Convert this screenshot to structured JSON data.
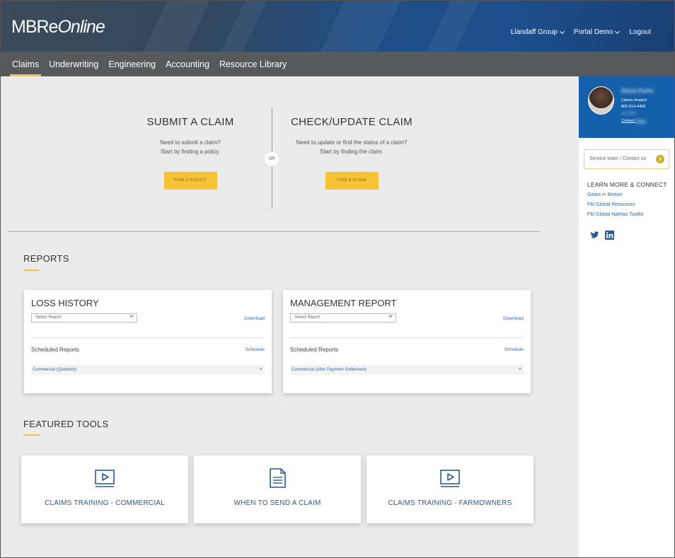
{
  "header": {
    "logo_main": "MBRe",
    "logo_italic": "Online",
    "links": [
      {
        "label": "Llandaff Group"
      },
      {
        "label": "Portal Demo"
      },
      {
        "label": "Logout"
      }
    ]
  },
  "nav": {
    "items": [
      "Claims",
      "Underwriting",
      "Engineering",
      "Accounting",
      "Resource Library"
    ],
    "active": "Claims"
  },
  "claims": {
    "submit": {
      "title": "SUBMIT A CLAIM",
      "desc_line1": "Need to submit a claim?",
      "desc_line2": "Start by finding a policy.",
      "button": "FIND A POLICY"
    },
    "or_label": "OR",
    "check": {
      "title": "CHECK/UPDATE CLAIM",
      "desc_line1": "Need to update or find the status of a claim?",
      "desc_line2": "Start by finding the claim.",
      "button": "FIND A CLAIM"
    }
  },
  "reports": {
    "section_title": "REPORTS",
    "cards": [
      {
        "title": "LOSS HISTORY",
        "select_placeholder": "Select Report",
        "download": "Download",
        "scheduled_label": "Scheduled Reports",
        "schedule_link": "Schedule",
        "scheduled_item": "Commercial (Quarterly)",
        "remove": "×"
      },
      {
        "title": "MANAGEMENT REPORT",
        "select_placeholder": "Select Report",
        "download": "Download",
        "scheduled_label": "Scheduled Reports",
        "schedule_link": "Schedule",
        "scheduled_item": "Commercial (After Payment Settlement)",
        "remove": "×"
      }
    ]
  },
  "tools": {
    "section_title": "FEATURED TOOLS",
    "items": [
      {
        "label": "CLAIMS TRAINING - COMMERCIAL",
        "icon": "video-play-icon"
      },
      {
        "label": "WHEN TO SEND A CLAIM",
        "icon": "document-icon"
      },
      {
        "label": "CLAIMS TRAINING - FARMOWNERS",
        "icon": "video-play-icon"
      }
    ]
  },
  "sidebar": {
    "profile": {
      "name": "Diana Parks",
      "role": "Claims Analyst",
      "phone": "800-814-4458",
      "ext": "ext 1870",
      "contact_label": "Contact",
      "contact_name": "Diana"
    },
    "service": {
      "label": "Service team / Contact us"
    },
    "learn": {
      "title": "LEARN MORE & CONNECT",
      "links": [
        "Gears in Motion",
        "FM Global Resources",
        "FM Global NatHaz Toolkit"
      ]
    }
  },
  "colors": {
    "accent_yellow": "#f7c233",
    "nav_bg": "#575a5d",
    "profile_blue": "#1560aa",
    "link_blue": "#2a6aa8"
  }
}
